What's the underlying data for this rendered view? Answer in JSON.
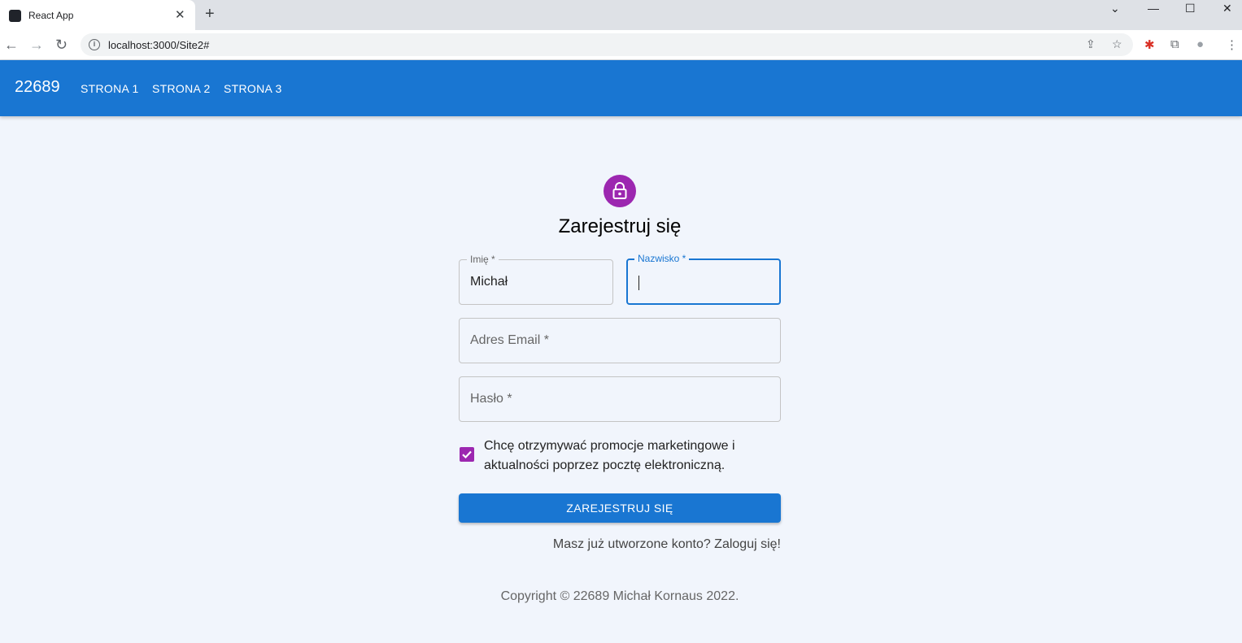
{
  "browser": {
    "tab_title": "React App",
    "tab_close": "✕",
    "new_tab": "+",
    "url": "localhost:3000/Site2#",
    "window_controls": {
      "dropdown": "⌄",
      "minimize": "—",
      "maximize": "☐",
      "close": "✕"
    },
    "icons": {
      "back": "←",
      "forward": "→",
      "reload": "↻",
      "share": "⇪",
      "star": "☆",
      "extension": "✱",
      "puzzle": "⧉",
      "profile": "●",
      "menu": "⋮",
      "info": "i"
    }
  },
  "appbar": {
    "brand": "22689",
    "links": [
      "STRONA 1",
      "STRONA 2",
      "STRONA 3"
    ]
  },
  "form": {
    "title": "Zarejestruj się",
    "first_name": {
      "label": "Imię *",
      "value": "Michał"
    },
    "last_name": {
      "label": "Nazwisko *",
      "value": ""
    },
    "email": {
      "placeholder": "Adres Email *"
    },
    "password": {
      "placeholder": "Hasło *"
    },
    "marketing_checkbox": {
      "checked": true,
      "label": "Chcę otrzymywać promocje marketingowe i aktualności poprzez pocztę elektroniczną."
    },
    "submit_label": "ZAREJESTRUJ SIĘ",
    "login_link": "Masz już utworzone konto? Zaloguj się!"
  },
  "footer": {
    "copyright": "Copyright © 22689 Michał Kornaus 2022."
  },
  "colors": {
    "primary": "#1976d2",
    "secondary": "#9c27b0",
    "background": "#f1f5fc"
  }
}
